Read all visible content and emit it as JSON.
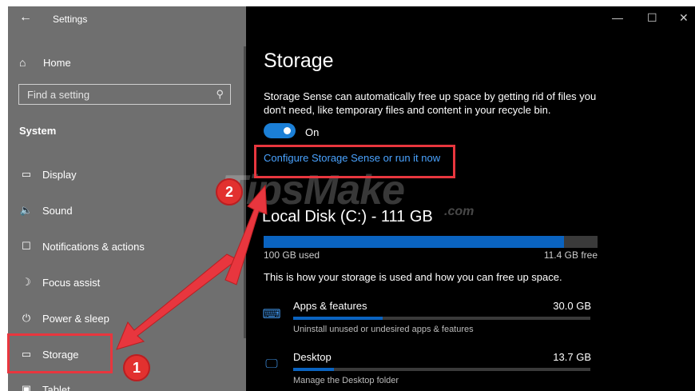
{
  "window": {
    "title": "Settings",
    "back_icon": "←",
    "controls": {
      "minimize": "—",
      "maximize": "☐",
      "close": "✕"
    }
  },
  "sidebar": {
    "home": {
      "icon": "⌂",
      "label": "Home"
    },
    "search": {
      "placeholder": "Find a setting",
      "icon": "⚲"
    },
    "section": "System",
    "items": [
      {
        "icon": "▭",
        "label": "Display"
      },
      {
        "icon": "🔈",
        "label": "Sound"
      },
      {
        "icon": "☐",
        "label": "Notifications & actions"
      },
      {
        "icon": "☽",
        "label": "Focus assist"
      },
      {
        "icon": "⏻",
        "label": "Power & sleep"
      },
      {
        "icon": "▭",
        "label": "Storage"
      },
      {
        "icon": "▣",
        "label": "Tablet"
      }
    ]
  },
  "main": {
    "title": "Storage",
    "description": "Storage Sense can automatically free up space by getting rid of files you don't need, like temporary files and content in your recycle bin.",
    "toggle_label": "On",
    "toggle_on": true,
    "configure_link": "Configure Storage Sense or run it now",
    "disk": {
      "title": "Local Disk (C:) - 111 GB",
      "used_label": "100 GB used",
      "free_label": "11.4 GB free",
      "used_fraction": 0.899
    },
    "usage_intro": "This is how your storage is used and how you can free up space.",
    "categories": [
      {
        "icon": "⌨",
        "label": "Apps & features",
        "size": "30.0 GB",
        "subtitle": "Uninstall unused or undesired apps & features",
        "fraction": 0.3
      },
      {
        "icon": "🖵",
        "label": "Desktop",
        "size": "13.7 GB",
        "subtitle": "Manage the Desktop folder",
        "fraction": 0.137
      }
    ]
  },
  "annotations": {
    "step1": "1",
    "step2": "2",
    "accent_color": "#e8363e"
  },
  "watermark": {
    "main": "TipsMake",
    "suffix": ".com"
  }
}
